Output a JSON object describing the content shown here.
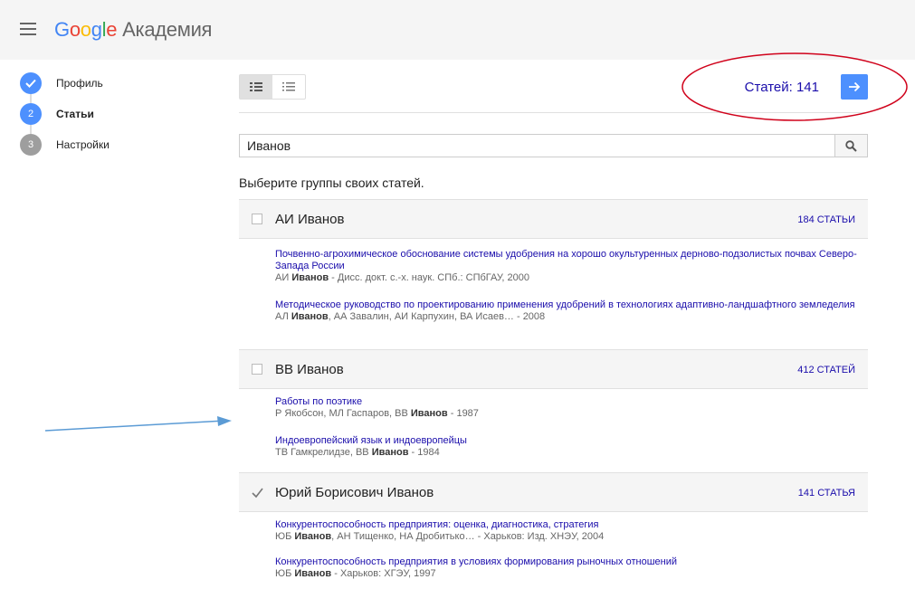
{
  "header": {
    "logo": "Google",
    "product": "Академия"
  },
  "steps": [
    {
      "label": "Профиль",
      "number": "",
      "state": "done"
    },
    {
      "label": "Статьи",
      "number": "2",
      "state": "active"
    },
    {
      "label": "Настройки",
      "number": "3",
      "state": "idle"
    }
  ],
  "toolbar": {
    "count_label": "Статей: 141",
    "next_icon": "arrow-right-icon"
  },
  "search": {
    "value": "Иванов",
    "icon": "search-icon"
  },
  "subtitle": "Выберите группы своих статей.",
  "groups": [
    {
      "name": "АИ Иванов",
      "count": "184 СТАТЬИ",
      "checked": false,
      "articles": [
        {
          "title": "Почвенно-агрохимическое обоснование системы удобрения на хорошо окультуренных дерново-подзолистых почвах Северо-Запада России",
          "meta_before": "АИ ",
          "meta_bold": "Иванов",
          "meta_after": " - Дисс. докт. с.-х. наук. СПб.: СПбГАУ, 2000"
        },
        {
          "title": "Методическое руководство по проектированию применения удобрений в технологиях адаптивно-ландшафтного земледелия",
          "meta_before": "АЛ ",
          "meta_bold": "Иванов",
          "meta_after": ", АА Завалин, АИ Карпухин, ВА Исаев… - 2008"
        }
      ]
    },
    {
      "name": "ВВ Иванов",
      "count": "412 СТАТЕЙ",
      "checked": false,
      "articles": [
        {
          "title": "Работы по поэтике",
          "meta_before": "Р Якобсон, МЛ Гаспаров, ВВ ",
          "meta_bold": "Иванов",
          "meta_after": " - 1987"
        },
        {
          "title": "Индоевропейский язык и индоевропейцы",
          "meta_before": "ТВ Гамкрелидзе, ВВ ",
          "meta_bold": "Иванов",
          "meta_after": " - 1984"
        }
      ]
    },
    {
      "name": "Юрий Борисович Иванов",
      "count": "141 СТАТЬЯ",
      "checked": true,
      "articles": [
        {
          "title": "Конкурентоспособность предприятия: оценка, диагностика, стратегия",
          "meta_before": "ЮБ ",
          "meta_bold": "Иванов",
          "meta_after": ", АН Тищенко, НА Дробитько… - Харьков: Изд. ХНЭУ, 2004"
        },
        {
          "title": "Конкурентоспособность предприятия в условиях формирования рыночных отношений",
          "meta_before": "ЮБ ",
          "meta_bold": "Иванов",
          "meta_after": " - Харьков: ХГЭУ, 1997"
        }
      ]
    }
  ],
  "colors": {
    "accent": "#4d90fe",
    "link": "#1a0dab",
    "annotation_ellipse": "#d0021b",
    "annotation_arrow": "#5b9bd5"
  }
}
